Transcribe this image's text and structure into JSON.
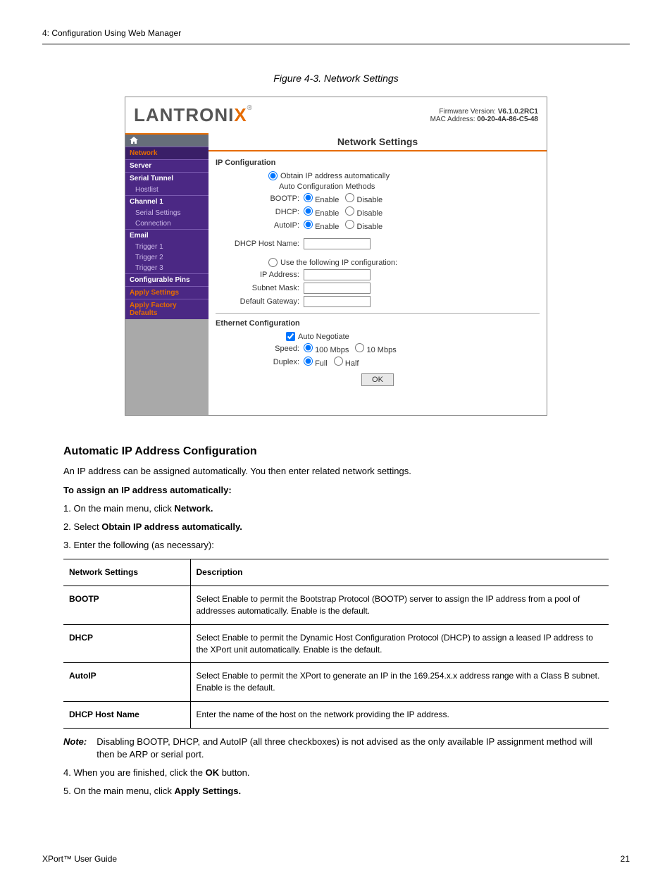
{
  "doc": {
    "chapter": "4: Configuration Using Web Manager",
    "figure_caption": "Figure 4-3. Network Settings",
    "footer_left": "XPort™ User Guide",
    "footer_right": "21"
  },
  "screenshot": {
    "logo_main": "LANTRONI",
    "logo_x": "X",
    "logo_reg": "®",
    "firmware_label": "Firmware Version:",
    "firmware_value": "V6.1.0.2RC1",
    "mac_label": "MAC Address:",
    "mac_value": "00-20-4A-86-C5-48",
    "nav": {
      "network": "Network",
      "server": "Server",
      "serial_tunnel": "Serial Tunnel",
      "hostlist": "Hostlist",
      "channel1": "Channel 1",
      "serial_settings": "Serial Settings",
      "connection": "Connection",
      "email": "Email",
      "trigger1": "Trigger 1",
      "trigger2": "Trigger 2",
      "trigger3": "Trigger 3",
      "conf_pins": "Configurable Pins",
      "apply_settings": "Apply Settings",
      "apply_defaults": "Apply Factory Defaults"
    },
    "content": {
      "title": "Network Settings",
      "ip_config": "IP Configuration",
      "obtain_auto": "Obtain IP address automatically",
      "auto_methods": "Auto Configuration Methods",
      "bootp": "BOOTP:",
      "dhcp": "DHCP:",
      "autoip": "AutoIP:",
      "enable": "Enable",
      "disable": "Disable",
      "dhcp_host": "DHCP Host Name:",
      "use_following": "Use the following IP configuration:",
      "ip_address": "IP Address:",
      "subnet": "Subnet Mask:",
      "gateway": "Default Gateway:",
      "eth_config": "Ethernet Configuration",
      "auto_neg": "Auto Negotiate",
      "speed": "Speed:",
      "speed_100": "100 Mbps",
      "speed_10": "10 Mbps",
      "duplex": "Duplex:",
      "full": "Full",
      "half": "Half",
      "ok": "OK"
    }
  },
  "bodytext": {
    "autoconf_h": "Automatic IP Address Configuration",
    "autoconf_p": "An IP address can be assigned automatically. You then enter related network settings.",
    "to_assign": "To assign an IP address automatically:",
    "step1_a": "1. On the main menu, click",
    "step1_b": "Network.",
    "step2_a": "2. Select",
    "step2_b": "Obtain IP address automatically.",
    "step3": "3. Enter the following (as necessary):",
    "table": {
      "h1": "Network Settings",
      "h2": "Description",
      "r1a": "BOOTP",
      "r1b": "Select Enable to permit the Bootstrap Protocol (BOOTP) server to assign the IP address from a pool of addresses automatically. Enable is the default.",
      "r2a": "DHCP",
      "r2b": "Select Enable to permit the Dynamic Host Configuration Protocol (DHCP) to assign a leased IP address to the XPort unit automatically. Enable is the default.",
      "r3a": "AutoIP",
      "r3b": "Select Enable to permit the XPort to generate an IP in the 169.254.x.x address range with a Class B subnet. Enable is the default.",
      "r4a": "DHCP Host Name",
      "r4b": "Enter the name of the host on the network providing the IP address."
    },
    "note_label": "Note:",
    "note_text": "Disabling BOOTP, DHCP, and AutoIP (all three checkboxes) is not advised as the only available IP assignment method will then be ARP or serial port.",
    "step4_a": "4. When you are finished, click the",
    "step4_b": "OK",
    "step4_c": "button.",
    "step5_a": "5. On the main menu, click",
    "step5_b": "Apply Settings."
  }
}
